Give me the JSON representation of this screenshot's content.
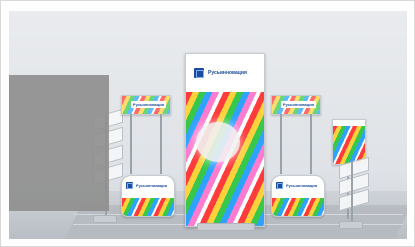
{
  "brand": {
    "logo_text": "Русьинновация",
    "logo_color": "#1c4c9c"
  }
}
